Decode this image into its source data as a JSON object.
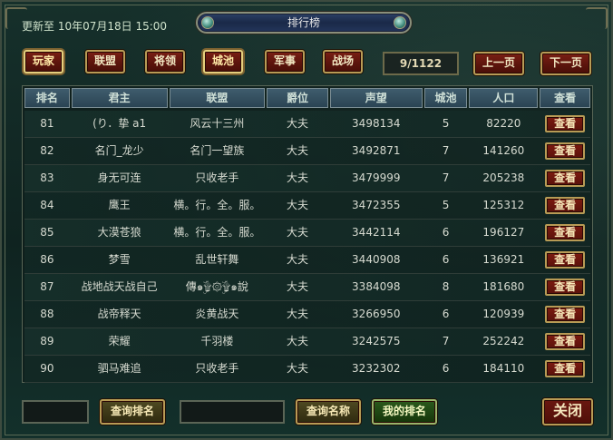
{
  "header": {
    "update_text": "更新至 10年07月18日 15:00",
    "title": "排行榜"
  },
  "tabs": [
    {
      "label": "玩家",
      "active": true
    },
    {
      "label": "联盟",
      "active": false
    },
    {
      "label": "将领",
      "active": false
    },
    {
      "label": "城池",
      "active": true
    },
    {
      "label": "军事",
      "active": false
    },
    {
      "label": "战场",
      "active": false
    }
  ],
  "pagination": {
    "page_text": "9/1122",
    "prev_label": "上一页",
    "next_label": "下一页"
  },
  "table": {
    "columns": [
      "排名",
      "君主",
      "联盟",
      "爵位",
      "声望",
      "城池",
      "人口",
      "查看"
    ],
    "rows": [
      {
        "rank": "81",
        "lord": "(り．挚 a1",
        "alliance": "风云十三州",
        "title": "大夫",
        "prestige": "3498134",
        "cities": "5",
        "population": "82220",
        "action": "查看"
      },
      {
        "rank": "82",
        "lord": "名门_龙少",
        "alliance": "名门一望族",
        "title": "大夫",
        "prestige": "3492871",
        "cities": "7",
        "population": "141260",
        "action": "查看"
      },
      {
        "rank": "83",
        "lord": "身无可连",
        "alliance": "只收老手",
        "title": "大夫",
        "prestige": "3479999",
        "cities": "7",
        "population": "205238",
        "action": "查看"
      },
      {
        "rank": "84",
        "lord": "鹰王",
        "alliance": "横。行。全。服。",
        "title": "大夫",
        "prestige": "3472355",
        "cities": "5",
        "population": "125312",
        "action": "查看"
      },
      {
        "rank": "85",
        "lord": "大漠苍狼",
        "alliance": "横。行。全。服。",
        "title": "大夫",
        "prestige": "3442114",
        "cities": "6",
        "population": "196127",
        "action": "查看"
      },
      {
        "rank": "86",
        "lord": "梦雪",
        "alliance": "乱世轩舞",
        "title": "大夫",
        "prestige": "3440908",
        "cities": "6",
        "population": "136921",
        "action": "查看"
      },
      {
        "rank": "87",
        "lord": "战地战天战自己",
        "alliance": "傳๑ۣۜ۩۞۩ۣۜ๑說",
        "title": "大夫",
        "prestige": "3384098",
        "cities": "8",
        "population": "181680",
        "action": "查看"
      },
      {
        "rank": "88",
        "lord": "战帝释天",
        "alliance": "炎黄战天",
        "title": "大夫",
        "prestige": "3266950",
        "cities": "6",
        "population": "120939",
        "action": "查看"
      },
      {
        "rank": "89",
        "lord": "荣耀",
        "alliance": "千羽楼",
        "title": "大夫",
        "prestige": "3242575",
        "cities": "7",
        "population": "252242",
        "action": "查看"
      },
      {
        "rank": "90",
        "lord": "驷马难追",
        "alliance": "只收老手",
        "title": "大夫",
        "prestige": "3232302",
        "cities": "6",
        "population": "184110",
        "action": "查看"
      }
    ]
  },
  "bottom": {
    "rank_input_value": "",
    "query_rank_label": "查询排名",
    "name_input_value": "",
    "query_name_label": "查询名称",
    "my_rank_label": "我的排名",
    "close_label": "关闭"
  }
}
